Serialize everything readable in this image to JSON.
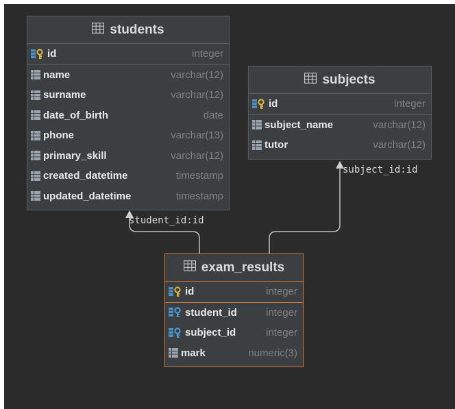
{
  "colors": {
    "background": "#2b2b2b",
    "table_bg": "#3c3f41",
    "selected_border": "#c97a3a",
    "column_name": "#e6e6e6",
    "column_type": "#808080",
    "pk_icon": "#e2b43a",
    "fk_icon": "#4a9fd8"
  },
  "tables": {
    "students": {
      "name": "students",
      "pk": {
        "name": "id",
        "type": "integer"
      },
      "columns": [
        {
          "name": "name",
          "type": "varchar(12)"
        },
        {
          "name": "surname",
          "type": "varchar(12)"
        },
        {
          "name": "date_of_birth",
          "type": "date"
        },
        {
          "name": "phone",
          "type": "varchar(13)"
        },
        {
          "name": "primary_skill",
          "type": "varchar(12)"
        },
        {
          "name": "created_datetime",
          "type": "timestamp"
        },
        {
          "name": "updated_datetime",
          "type": "timestamp"
        }
      ]
    },
    "subjects": {
      "name": "subjects",
      "pk": {
        "name": "id",
        "type": "integer"
      },
      "columns": [
        {
          "name": "subject_name",
          "type": "varchar(12)"
        },
        {
          "name": "tutor",
          "type": "varchar(12)"
        }
      ]
    },
    "exam_results": {
      "name": "exam_results",
      "pk": {
        "name": "id",
        "type": "integer"
      },
      "fks": [
        {
          "name": "student_id",
          "type": "integer"
        },
        {
          "name": "subject_id",
          "type": "integer"
        }
      ],
      "columns": [
        {
          "name": "mark",
          "type": "numeric(3)"
        }
      ]
    }
  },
  "relations": {
    "student": "student_id:id",
    "subject": "subject_id:id"
  }
}
